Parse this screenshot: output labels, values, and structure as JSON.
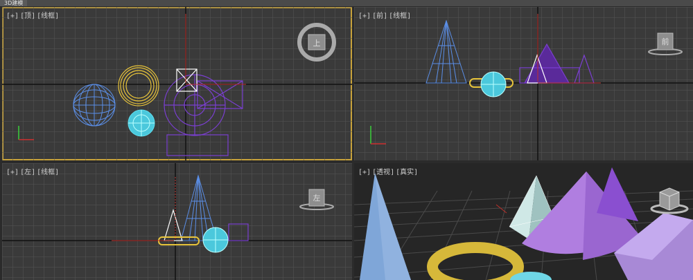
{
  "app": {
    "tab_title": "3D建模"
  },
  "viewports": {
    "top": {
      "plus": "[+]",
      "view": "[顶]",
      "mode": "[线框]"
    },
    "front": {
      "plus": "[+]",
      "view": "[前]",
      "mode": "[线框]"
    },
    "left": {
      "plus": "[+]",
      "view": "[左]",
      "mode": "[线框]"
    },
    "persp": {
      "plus": "[+]",
      "view": "[透视]",
      "mode": "[真实]"
    }
  },
  "viewcube": {
    "top": "上",
    "front": "前",
    "left": "左"
  },
  "colors": {
    "bg": "#3a3a3a",
    "grid": "#555555",
    "axis": "#111111",
    "active_border": "#c8a23a",
    "purple": "#7a3fd0",
    "blue": "#5b8fe8",
    "yellow": "#e8c43a",
    "cyan": "#5fe0f0"
  }
}
